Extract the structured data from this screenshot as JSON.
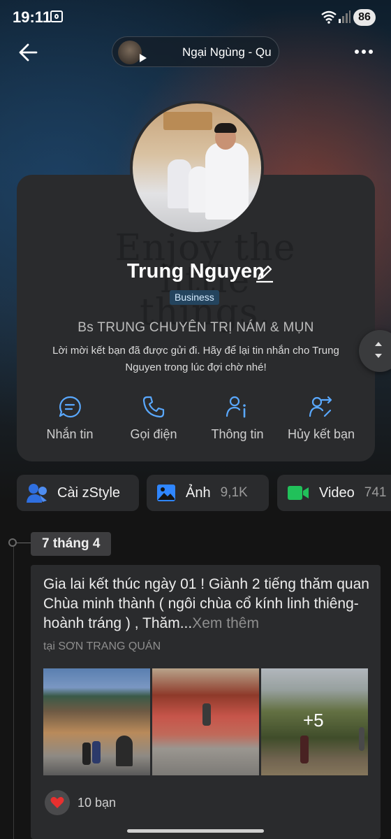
{
  "status_bar": {
    "time": "19:11",
    "battery": "86"
  },
  "music": {
    "title": "Ngại Ngùng - Qu"
  },
  "profile": {
    "watermark": "Enjoy the little things.",
    "name": "Trung Nguyen",
    "badge": "Business",
    "bio": "Bs TRUNG CHUYÊN TRỊ NÁM & MỤN",
    "friend_request_message": "Lời mời kết bạn đã được gửi đi. Hãy để lại tin nhắn cho Trung Nguyen trong lúc đợi chờ nhé!"
  },
  "actions": [
    {
      "label": "Nhắn tin",
      "icon": "chat-icon"
    },
    {
      "label": "Gọi điện",
      "icon": "phone-icon"
    },
    {
      "label": "Thông tin",
      "icon": "user-info-icon"
    },
    {
      "label": "Hủy kết bạn",
      "icon": "cancel-friend-icon"
    }
  ],
  "tabs": [
    {
      "label": "Cài zStyle",
      "count": "",
      "icon": "zstyle-icon"
    },
    {
      "label": "Ảnh",
      "count": "9,1K",
      "icon": "image-icon"
    },
    {
      "label": "Video",
      "count": "741",
      "icon": "video-icon"
    }
  ],
  "timeline": {
    "date": "7 tháng 4",
    "post": {
      "text": "Gia lai kết thúc ngày 01 ! Giành 2 tiếng thăm quan Chùa minh thành ( ngôi chùa cổ kính linh thiêng- hoành tráng ) , Thăm...",
      "see_more": "Xem thêm",
      "location": "tại SƠN TRANG QUÁN",
      "more_photos": "+5",
      "likes": "10 bạn"
    }
  },
  "colors": {
    "accent": "#5aa9ff",
    "card": "#2a2b2d",
    "background": "#141414",
    "like": "#e8302f"
  }
}
